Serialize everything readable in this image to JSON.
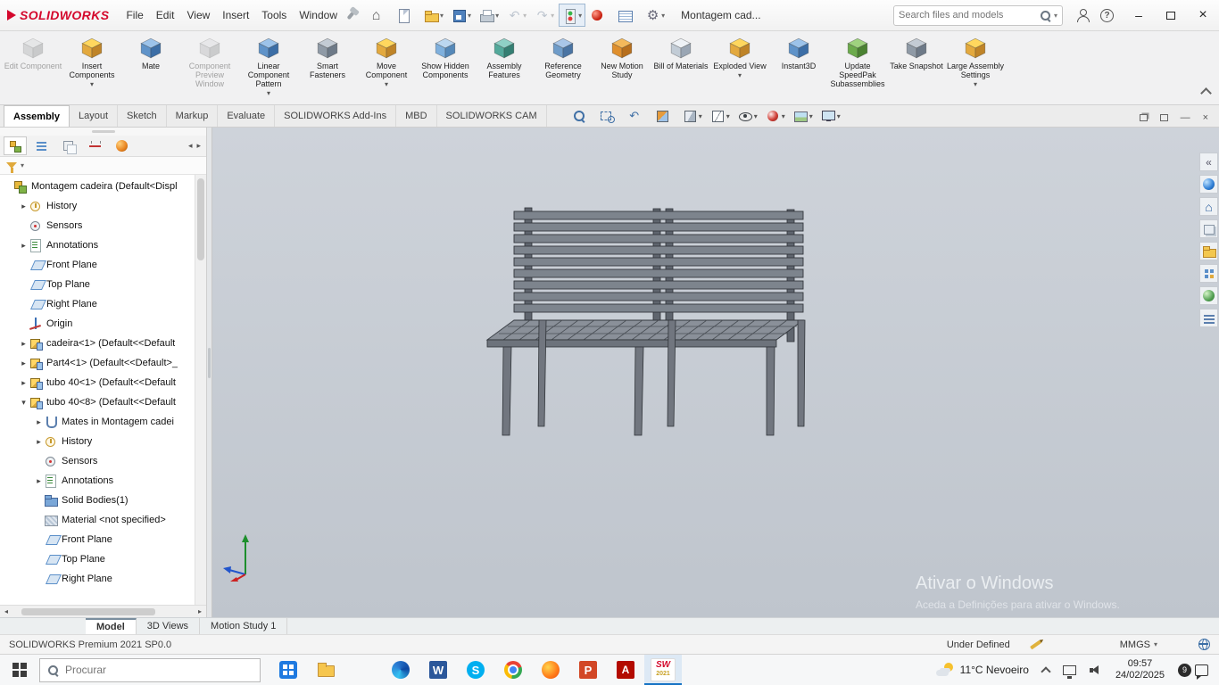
{
  "titlebar": {
    "logo_text": "SOLIDWORKS",
    "menus": [
      "File",
      "Edit",
      "View",
      "Insert",
      "Tools",
      "Window"
    ],
    "doc_title": "Montagem cad...",
    "search_placeholder": "Search files and models",
    "quick_buttons": [
      {
        "name": "home-button",
        "icon": "qi-home"
      },
      {
        "name": "new-document-button",
        "icon": "qi-page"
      },
      {
        "name": "open-button",
        "icon": "qi-folder",
        "dd": true
      },
      {
        "name": "save-button",
        "icon": "qi-floppy",
        "dd": true
      },
      {
        "name": "print-button",
        "icon": "qi-printer",
        "dd": true
      },
      {
        "name": "undo-button",
        "icon": "qi-undo",
        "dd": true,
        "disabled": true
      },
      {
        "name": "redo-button",
        "icon": "qi-redo",
        "dd": true,
        "disabled": true
      },
      {
        "name": "rebuild-button",
        "icon": "qi-traffic",
        "dd": true,
        "cls": "boxed"
      },
      {
        "name": "edit-appearance-button",
        "icon": "qi-ball"
      },
      {
        "name": "file-properties-button",
        "icon": "qi-table"
      },
      {
        "name": "options-button",
        "icon": "qi-gear",
        "dd": true
      }
    ]
  },
  "ribbon": {
    "buttons": [
      {
        "label": "Edit Component",
        "disabled": true,
        "c": [
          "#d3dae1",
          "#aeb7c1",
          "#929ca8"
        ]
      },
      {
        "label": "Insert Components",
        "dd": true,
        "c": [
          "#ffd75e",
          "#e3a93e",
          "#bf8428"
        ]
      },
      {
        "label": "Mate",
        "c": [
          "#9cc3ea",
          "#5f93c9",
          "#3c6ea6"
        ]
      },
      {
        "label": "Component Preview Window",
        "disabled": true,
        "c": [
          "#d9dee4",
          "#b6bdc6",
          "#98a1ac"
        ]
      },
      {
        "label": "Linear Component Pattern",
        "dd": true,
        "c": [
          "#9cc3ea",
          "#5f93c9",
          "#3c6ea6"
        ]
      },
      {
        "label": "Smart Fasteners",
        "c": [
          "#c3cbd4",
          "#8f9aa6",
          "#6e7a88"
        ]
      },
      {
        "label": "Move Component",
        "dd": true,
        "c": [
          "#ffd75e",
          "#e3a93e",
          "#bf8428"
        ]
      },
      {
        "label": "Show Hidden Components",
        "c": [
          "#bcd7f0",
          "#7fb0dd",
          "#5588b8"
        ]
      },
      {
        "label": "Assembly Features",
        "c": [
          "#8fd0c6",
          "#53a99b",
          "#357f73"
        ]
      },
      {
        "label": "Reference Geometry",
        "c": [
          "#a9c6e8",
          "#6f9cc9",
          "#4a74a3"
        ]
      },
      {
        "label": "New Motion Study",
        "c": [
          "#f4b95b",
          "#df8f2d",
          "#b76f1d"
        ]
      },
      {
        "label": "Bill of Materials",
        "c": [
          "#eef2f6",
          "#c2ccd6",
          "#9aa6b4"
        ]
      },
      {
        "label": "Exploded View",
        "dd": true,
        "c": [
          "#ffd75e",
          "#e3a93e",
          "#bf8428"
        ]
      },
      {
        "label": "Instant3D",
        "c": [
          "#9cc3ea",
          "#5f93c9",
          "#3c6ea6"
        ]
      },
      {
        "label": "Update SpeedPak Subassemblies",
        "c": [
          "#9fd27f",
          "#6cab4c",
          "#4b8232"
        ]
      },
      {
        "label": "Take Snapshot",
        "c": [
          "#c3cbd4",
          "#8f9aa6",
          "#6e7a88"
        ]
      },
      {
        "label": "Large Assembly Settings",
        "dd": true,
        "c": [
          "#ffd75e",
          "#e3a93e",
          "#bf8428"
        ]
      }
    ]
  },
  "tabs": {
    "items": [
      {
        "label": "Assembly",
        "active": true
      },
      {
        "label": "Layout"
      },
      {
        "label": "Sketch"
      },
      {
        "label": "Markup"
      },
      {
        "label": "Evaluate"
      },
      {
        "label": "SOLIDWORKS Add-Ins"
      },
      {
        "label": "MBD"
      },
      {
        "label": "SOLIDWORKS CAM"
      }
    ]
  },
  "hud": {
    "buttons": [
      {
        "name": "zoom-to-fit-button",
        "icon": "h-mag"
      },
      {
        "name": "zoom-to-area-button",
        "icon": "h-zoomarea"
      },
      {
        "name": "previous-view-button",
        "icon": "h-prev"
      },
      {
        "name": "section-view-button",
        "icon": "h-section"
      },
      {
        "name": "view-orientation-button",
        "icon": "h-cube",
        "dd": true
      },
      {
        "name": "display-style-button",
        "icon": "h-cube2",
        "dd": true
      },
      {
        "name": "hide-show-items-button",
        "icon": "h-eye",
        "dd": true
      },
      {
        "name": "edit-appearance-button",
        "icon": "h-ball",
        "dd": true
      },
      {
        "name": "apply-scene-button",
        "icon": "h-scene",
        "dd": true
      },
      {
        "name": "view-settings-button",
        "icon": "h-monitor",
        "dd": true
      }
    ]
  },
  "panel_tabs": {
    "items": [
      {
        "name": "featuremanager-tab",
        "icon": "pti-tree",
        "active": true
      },
      {
        "name": "propertymanager-tab",
        "icon": "pti-props"
      },
      {
        "name": "configurationmanager-tab",
        "icon": "pti-config"
      },
      {
        "name": "dimxpertmanager-tab",
        "icon": "pti-dim"
      },
      {
        "name": "displaymanager-tab",
        "icon": "pti-display"
      }
    ]
  },
  "tree": {
    "items": [
      {
        "label": "Montagem cadeira (Default<Displ",
        "icon": "ti-assembly",
        "level": 0
      },
      {
        "label": "History",
        "icon": "ti-history",
        "level": 1,
        "exp": "closed"
      },
      {
        "label": "Sensors",
        "icon": "ti-sensors",
        "level": 1
      },
      {
        "label": "Annotations",
        "icon": "ti-annotations",
        "level": 1,
        "exp": "closed"
      },
      {
        "label": "Front Plane",
        "icon": "ti-plane",
        "level": 1
      },
      {
        "label": "Top Plane",
        "icon": "ti-plane",
        "level": 1
      },
      {
        "label": "Right Plane",
        "icon": "ti-plane",
        "level": 1
      },
      {
        "label": "Origin",
        "icon": "ti-origin",
        "level": 1
      },
      {
        "label": "cadeira<1> (Default<<Default",
        "icon": "ti-part",
        "level": 1,
        "exp": "closed"
      },
      {
        "label": "Part4<1> (Default<<Default>_",
        "icon": "ti-part",
        "level": 1,
        "exp": "closed"
      },
      {
        "label": "tubo 40<1> (Default<<Default",
        "icon": "ti-part",
        "level": 1,
        "exp": "closed"
      },
      {
        "label": "tubo 40<8> (Default<<Default",
        "icon": "ti-part",
        "level": 1,
        "exp": "open"
      },
      {
        "label": "Mates in Montagem cadei",
        "icon": "ti-mates",
        "level": 2,
        "exp": "closed"
      },
      {
        "label": "History",
        "icon": "ti-history",
        "level": 2,
        "exp": "closed"
      },
      {
        "label": "Sensors",
        "icon": "ti-sensors",
        "level": 2
      },
      {
        "label": "Annotations",
        "icon": "ti-annotations",
        "level": 2,
        "exp": "closed"
      },
      {
        "label": "Solid Bodies(1)",
        "icon": "ti-solidbodies",
        "level": 2
      },
      {
        "label": "Material <not specified>",
        "icon": "ti-material",
        "level": 2
      },
      {
        "label": "Front Plane",
        "icon": "ti-plane",
        "level": 2
      },
      {
        "label": "Top Plane",
        "icon": "ti-plane",
        "level": 2
      },
      {
        "label": "Right Plane",
        "icon": "ti-plane",
        "level": 2
      }
    ]
  },
  "taskpane": {
    "items": [
      {
        "name": "taskpane-collapse-button",
        "icon": "tp-chev"
      },
      {
        "name": "solidworks-resources-tab",
        "icon": "tp-sphere"
      },
      {
        "name": "home-tab",
        "icon": "tp-home"
      },
      {
        "name": "design-library-tab",
        "icon": "tp-book"
      },
      {
        "name": "file-explorer-tab",
        "icon": "tp-folder"
      },
      {
        "name": "view-palette-tab",
        "icon": "tp-grid"
      },
      {
        "name": "appearances-tab",
        "icon": "tp-ball2"
      },
      {
        "name": "custom-properties-tab",
        "icon": "tp-list"
      }
    ]
  },
  "viewport": {
    "watermark_line1": "Ativar o Windows",
    "watermark_line2": "Aceda a Definições para ativar o Windows."
  },
  "doc_tabs": {
    "items": [
      {
        "label": "Model",
        "active": true
      },
      {
        "label": "3D Views"
      },
      {
        "label": "Motion Study 1"
      }
    ]
  },
  "statusbar": {
    "left": "SOLIDWORKS Premium 2021 SP0.0",
    "state": "Under Defined",
    "units": "MMGS"
  },
  "taskbar": {
    "search_placeholder": "Procurar",
    "apps": [
      {
        "name": "store-icon",
        "icon": "a-store"
      },
      {
        "name": "file-explorer-icon",
        "icon": "a-folder"
      },
      {
        "name": "edge-legacy-icon",
        "icon": "a-e"
      },
      {
        "name": "edge-icon",
        "icon": "a-edge"
      },
      {
        "name": "word-icon",
        "icon": "a-word"
      },
      {
        "name": "skype-icon",
        "icon": "a-skype"
      },
      {
        "name": "chrome-icon",
        "icon": "a-chrome"
      },
      {
        "name": "firefox-icon",
        "icon": "a-ff"
      },
      {
        "name": "powerpoint-icon",
        "icon": "a-ppt"
      },
      {
        "name": "acrobat-icon",
        "icon": "a-pdf"
      }
    ],
    "sw_mark": "SW",
    "sw_year": "2021",
    "weather": "11°C Nevoeiro",
    "time": "09:57",
    "date": "24/02/2025",
    "badge": "9"
  }
}
